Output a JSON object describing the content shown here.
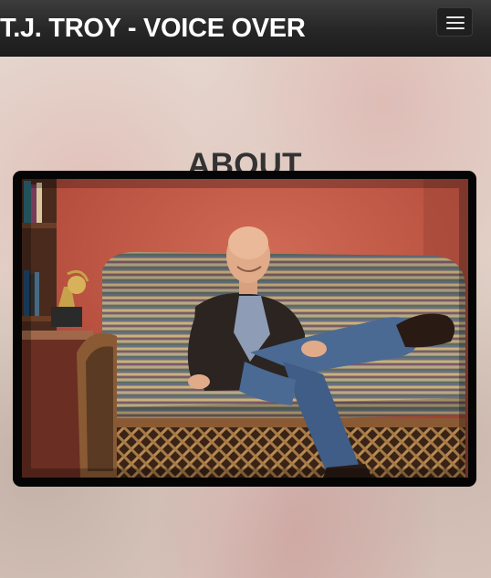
{
  "header": {
    "brand": "T.J. TROY - VOICE OVER",
    "menu_toggle_icon": "hamburger-icon"
  },
  "main": {
    "section_title": "ABOUT",
    "photo": {
      "description_icon": "portrait-photo",
      "subject": "man seated on striped couch"
    }
  },
  "colors": {
    "navbar": "#262626",
    "brand_text": "#ffffff",
    "title_text": "#333333",
    "frame": "#050505",
    "wall": "#c25a48"
  }
}
